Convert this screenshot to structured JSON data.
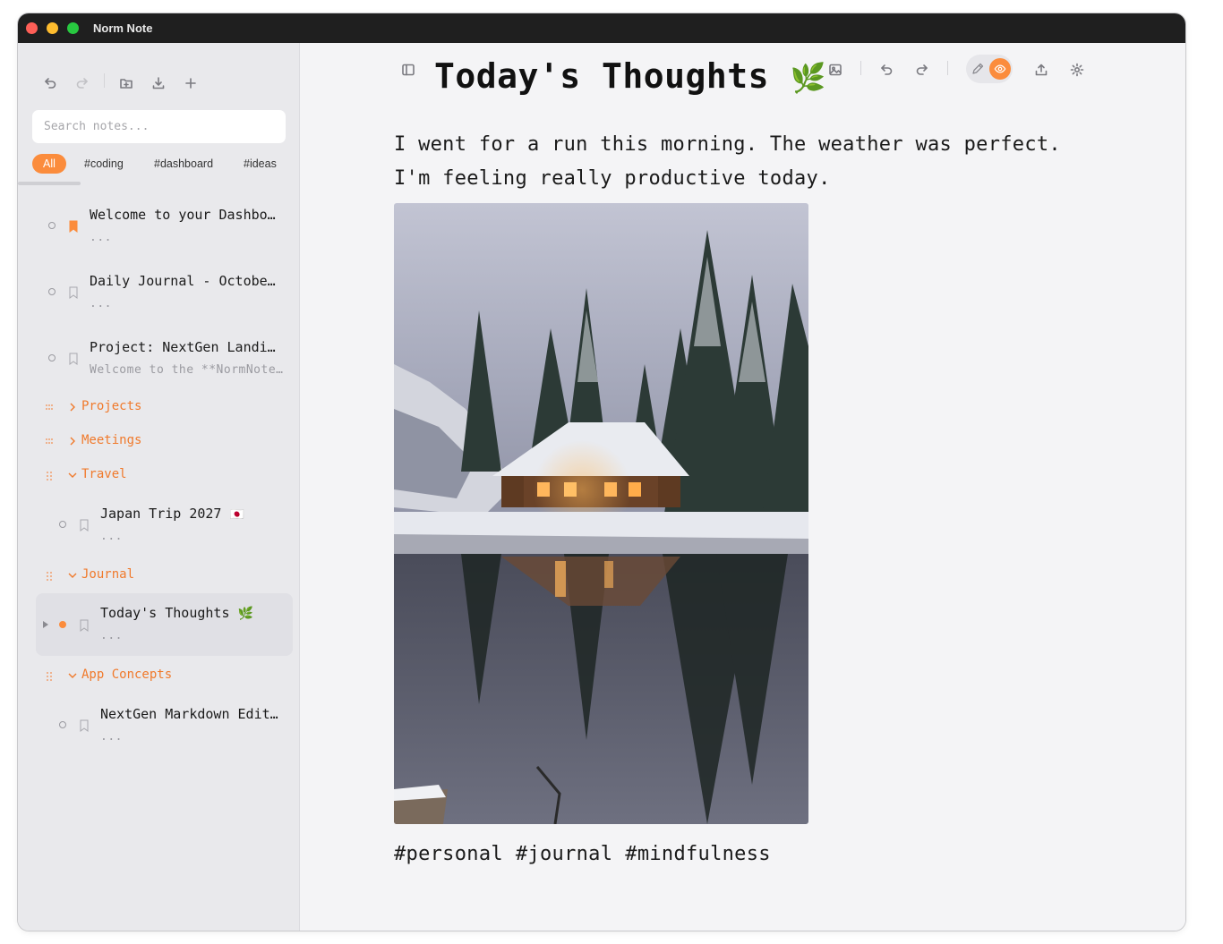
{
  "app": {
    "title": "Norm Note"
  },
  "sidebar": {
    "search": {
      "placeholder": "Search notes...",
      "value": ""
    },
    "tag_filters": [
      "All",
      "#coding",
      "#dashboard",
      "#ideas"
    ],
    "active_tag": "All",
    "notes": [
      {
        "title": "Welcome to your Dashbo…",
        "preview": "...",
        "bookmarked": true
      },
      {
        "title": "Daily Journal - Octobe…",
        "preview": "...",
        "bookmarked": false
      },
      {
        "title": "Project: NextGen Landi…",
        "preview": "Welcome to the **NormNote…",
        "bookmarked": false
      }
    ],
    "folders": [
      {
        "name": "Projects",
        "expanded": false
      },
      {
        "name": "Meetings",
        "expanded": false
      },
      {
        "name": "Travel",
        "expanded": true,
        "notes": [
          {
            "title": "Japan Trip 2027",
            "emoji": "🇯🇵",
            "preview": "..."
          }
        ]
      },
      {
        "name": "Journal",
        "expanded": true,
        "notes": [
          {
            "title": "Today's Thoughts",
            "emoji": "🌿",
            "preview": "...",
            "selected": true
          }
        ]
      },
      {
        "name": "App Concepts",
        "expanded": true,
        "notes": [
          {
            "title": "NextGen Markdown Edit…",
            "preview": "..."
          }
        ]
      }
    ]
  },
  "document": {
    "title": "Today's Thoughts",
    "title_emoji": "🌿",
    "mode": "preview",
    "body_lines": [
      "I went for a run this morning. The weather was perfect.",
      "I'm feeling really productive today."
    ],
    "tags": [
      "#personal",
      "#journal",
      "#mindfulness"
    ]
  },
  "colors": {
    "accent": "#fb8c3c",
    "folder_text": "#f07a2c",
    "titlebar": "#1f1f1f"
  },
  "icons": {
    "sidebar_toolbar": [
      "undo-icon",
      "redo-icon",
      "new-folder-icon",
      "download-icon",
      "plus-icon"
    ],
    "doc_toolbar": [
      "sidebar-toggle-icon",
      "image-icon",
      "undo-icon",
      "redo-icon",
      "pen-icon",
      "eye-icon",
      "share-icon",
      "gear-icon"
    ]
  }
}
